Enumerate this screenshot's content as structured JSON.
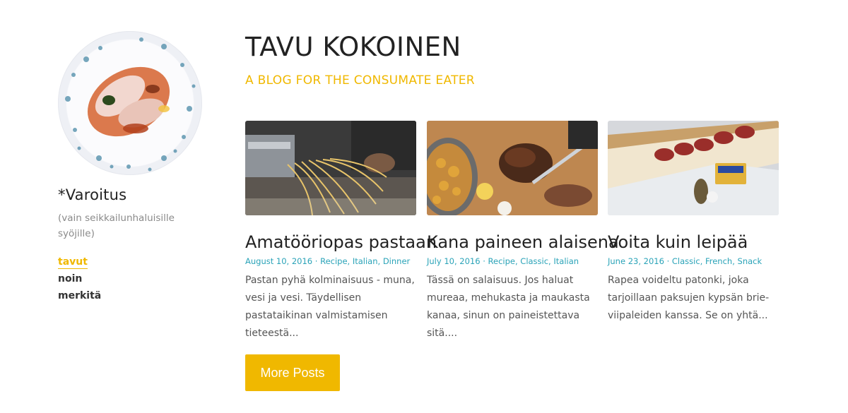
{
  "sidebar": {
    "site_name": "*Varoitus",
    "site_description": "(vain seikkailunhaluisille syöjille)",
    "nav": [
      {
        "label": "tavut",
        "active": true
      },
      {
        "label": "noin",
        "active": false
      },
      {
        "label": "merkitä",
        "active": false
      }
    ]
  },
  "header": {
    "title": "TAVU KOKOINEN",
    "tagline": "A BLOG FOR THE CONSUMATE EATER"
  },
  "posts": [
    {
      "title": "Amatööriopas pastaan",
      "date": "August 10, 2016",
      "tags": "Recipe, Italian, Dinner",
      "excerpt": "Pastan pyhä kolminaisuus - muna, vesi ja vesi. Täydellisen pastataikinan valmistamisen tieteestä..."
    },
    {
      "title": "Kana paineen alaisena",
      "date": "July 10, 2016",
      "tags": "Recipe, Classic, Italian",
      "excerpt": "Tässä on salaisuus. Jos haluat mureaa, mehukasta ja maukasta kanaa, sinun on paineistettava sitä...."
    },
    {
      "title": "Voita kuin leipää",
      "date": "June 23, 2016",
      "tags": "Classic, French, Snack",
      "excerpt": "Rapea voideltu patonki, joka tarjoillaan paksujen kypsän brie-viipaleiden kanssa. Se on yhtä..."
    }
  ],
  "more_button": "More Posts",
  "colors": {
    "accent": "#f0b800",
    "meta": "#2aa3b8",
    "title": "#222222"
  }
}
